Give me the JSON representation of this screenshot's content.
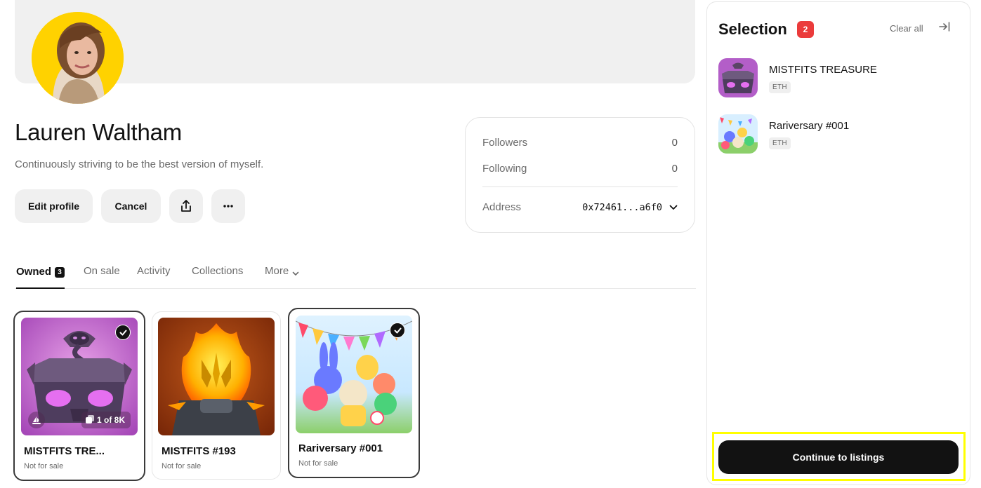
{
  "profile": {
    "name": "Lauren Waltham",
    "bio": "Continuously striving to be the best version of myself.",
    "avatar_icon": "profile-photo",
    "avatar_bg": "#ffd200"
  },
  "actions": {
    "edit_label": "Edit profile",
    "cancel_label": "Cancel",
    "share_icon": "share-icon",
    "more_icon": "ellipsis-icon"
  },
  "stats": {
    "followers_label": "Followers",
    "followers_value": "0",
    "following_label": "Following",
    "following_value": "0",
    "address_label": "Address",
    "address_value": "0x72461...a6f0"
  },
  "tabs": [
    {
      "label": "Owned",
      "count": "3",
      "active": true
    },
    {
      "label": "On sale"
    },
    {
      "label": "Activity"
    },
    {
      "label": "Collections"
    },
    {
      "label": "More"
    }
  ],
  "cards": [
    {
      "title": "MISTFITS TRE...",
      "status": "Not for sale",
      "editions": "1 of 8K",
      "selected": true
    },
    {
      "title": "MISTFITS #193",
      "status": "Not for sale",
      "selected": false
    },
    {
      "title": "Rariversary #001",
      "status": "Not for sale",
      "selected": true
    }
  ],
  "selection": {
    "title": "Selection",
    "count": "2",
    "clear_label": "Clear all",
    "items": [
      {
        "name": "MISTFITS TREASURE",
        "chain": "ETH"
      },
      {
        "name": "Rariversary #001",
        "chain": "ETH"
      }
    ],
    "continue_label": "Continue to listings"
  },
  "colors": {
    "accent": "#121212",
    "badge_red": "#eb3b3b",
    "highlight": "#ffff00"
  }
}
